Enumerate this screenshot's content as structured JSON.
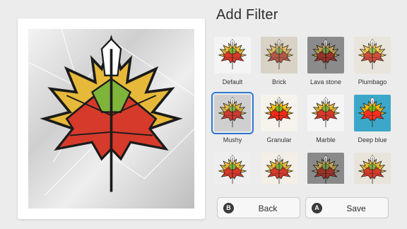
{
  "panel": {
    "title": "Add Filter"
  },
  "filters": [
    {
      "label": "Default",
      "bg": "#f4f4f4",
      "tint": ""
    },
    {
      "label": "Brick",
      "bg": "#d9d2c6",
      "tint": "brick"
    },
    {
      "label": "Lava stone",
      "bg": "#8b8b8b",
      "tint": "stone"
    },
    {
      "label": "Plumbago",
      "bg": "#e9e5dc",
      "tint": "plumbago"
    },
    {
      "label": "Mushy",
      "bg": "#cfcfcf",
      "tint": "mushy"
    },
    {
      "label": "Granular",
      "bg": "#f6f2ec",
      "tint": "granular"
    },
    {
      "label": "Marble",
      "bg": "#f5f5f5",
      "tint": ""
    },
    {
      "label": "Deep blue",
      "bg": "#3ca7c8",
      "tint": "blue"
    },
    {
      "label": "",
      "bg": "#eeeeee",
      "tint": ""
    },
    {
      "label": "",
      "bg": "#f3efe6",
      "tint": ""
    },
    {
      "label": "",
      "bg": "#8a8a8a",
      "tint": "stone"
    },
    {
      "label": "",
      "bg": "#e8e4dc",
      "tint": ""
    }
  ],
  "selected_filter": "Mushy",
  "buttons": {
    "back": {
      "badge": "B",
      "label": "Back"
    },
    "save": {
      "badge": "A",
      "label": "Save"
    }
  },
  "colors": {
    "accent": "#2f78d6"
  }
}
